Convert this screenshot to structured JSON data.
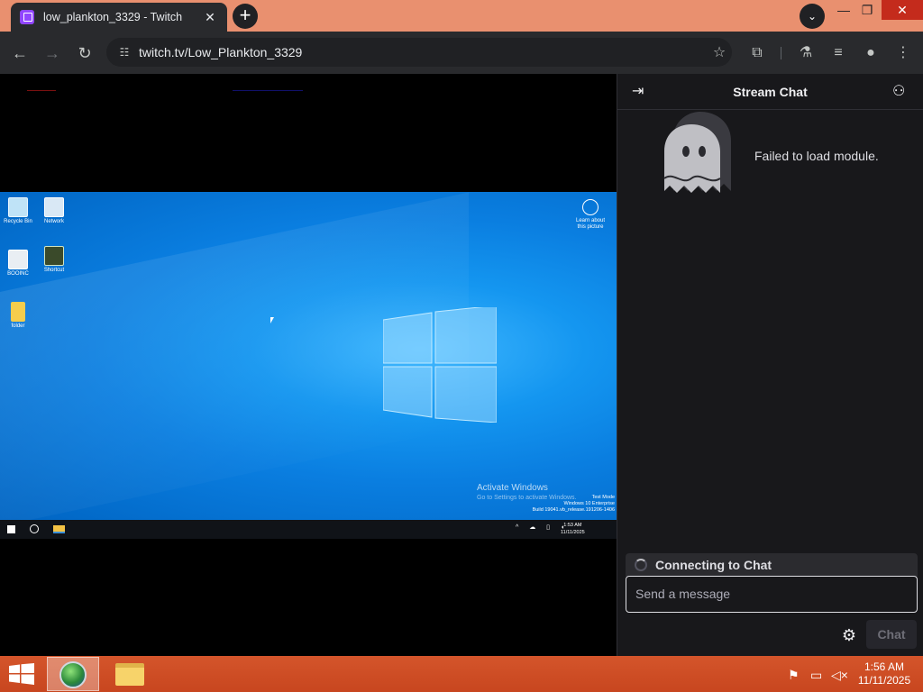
{
  "browser": {
    "tab_title": "low_plankton_3329 - Twitch",
    "url": "twitch.tv/Low_Plankton_3329",
    "icons": {
      "tab_close": "close-icon",
      "new_tab": "plus-icon",
      "tab_search": "chevron-down-icon",
      "back": "arrow-left-icon",
      "forward": "arrow-right-icon",
      "reload": "reload-icon",
      "site_info": "tune-icon",
      "bookmark": "star-icon",
      "extensions": "puzzle-icon",
      "labs": "flask-icon",
      "media": "queue-music-icon",
      "profile": "person-icon",
      "menu": "kebab-menu-icon"
    },
    "title_bar_color": "#e9906f"
  },
  "stream_desktop": {
    "icons": [
      {
        "label": "Recycle Bin"
      },
      {
        "label": "Network"
      },
      {
        "label": "BOOINC"
      },
      {
        "label": "Shortcut"
      },
      {
        "label": "folder"
      }
    ],
    "learn_about": "Learn about this picture",
    "activate_title": "Activate Windows",
    "activate_sub": "Go to Settings to activate Windows.",
    "test_mode": "Test Mode",
    "edition": "Windows 10 Enterprise",
    "build": "Build 19041.vb_release.191206-1406",
    "clock_time": "1:53 AM",
    "clock_date": "11/11/2025"
  },
  "chat": {
    "title": "Stream Chat",
    "error": "Failed to load module.",
    "status": "Connecting to Chat",
    "input_placeholder": "Send a message",
    "send_label": "Chat",
    "accent": "#9146ff"
  },
  "taskbar": {
    "time": "1:56 AM",
    "date": "11/11/2025",
    "color": "#d4552b"
  }
}
